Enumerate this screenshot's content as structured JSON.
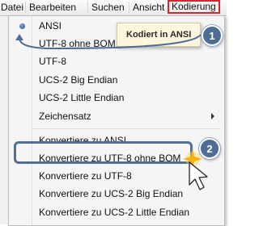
{
  "menubar": {
    "items": [
      {
        "label": "Datei"
      },
      {
        "label": "Bearbeiten"
      },
      {
        "label": "Suchen"
      },
      {
        "label": "Ansicht"
      },
      {
        "label": "Kodierung"
      }
    ]
  },
  "dropdown": {
    "items": [
      {
        "label": "ANSI",
        "checked": true
      },
      {
        "label": "UTF-8 ohne BOM"
      },
      {
        "label": "UTF-8"
      },
      {
        "label": "UCS-2 Big Endian"
      },
      {
        "label": "UCS-2 Little Endian"
      },
      {
        "label": "Zeichensatz",
        "submenu": true
      },
      {
        "label": "Konvertiere zu ANSI"
      },
      {
        "label": "Konvertiere zu UTF-8 ohne BOM"
      },
      {
        "label": "Konvertiere zu UTF-8"
      },
      {
        "label": "Konvertiere zu UCS-2 Big Endian"
      },
      {
        "label": "Konvertiere zu UCS-2 Little Endian"
      }
    ]
  },
  "tooltip": {
    "text": "Kodiert in ANSI"
  },
  "badges": {
    "one": "1",
    "two": "2"
  },
  "colors": {
    "accent": "#4d6d97",
    "active_border": "#d4262c",
    "tooltip_bg": "#fdf5dc",
    "highlight_border": "#4f6f98"
  }
}
